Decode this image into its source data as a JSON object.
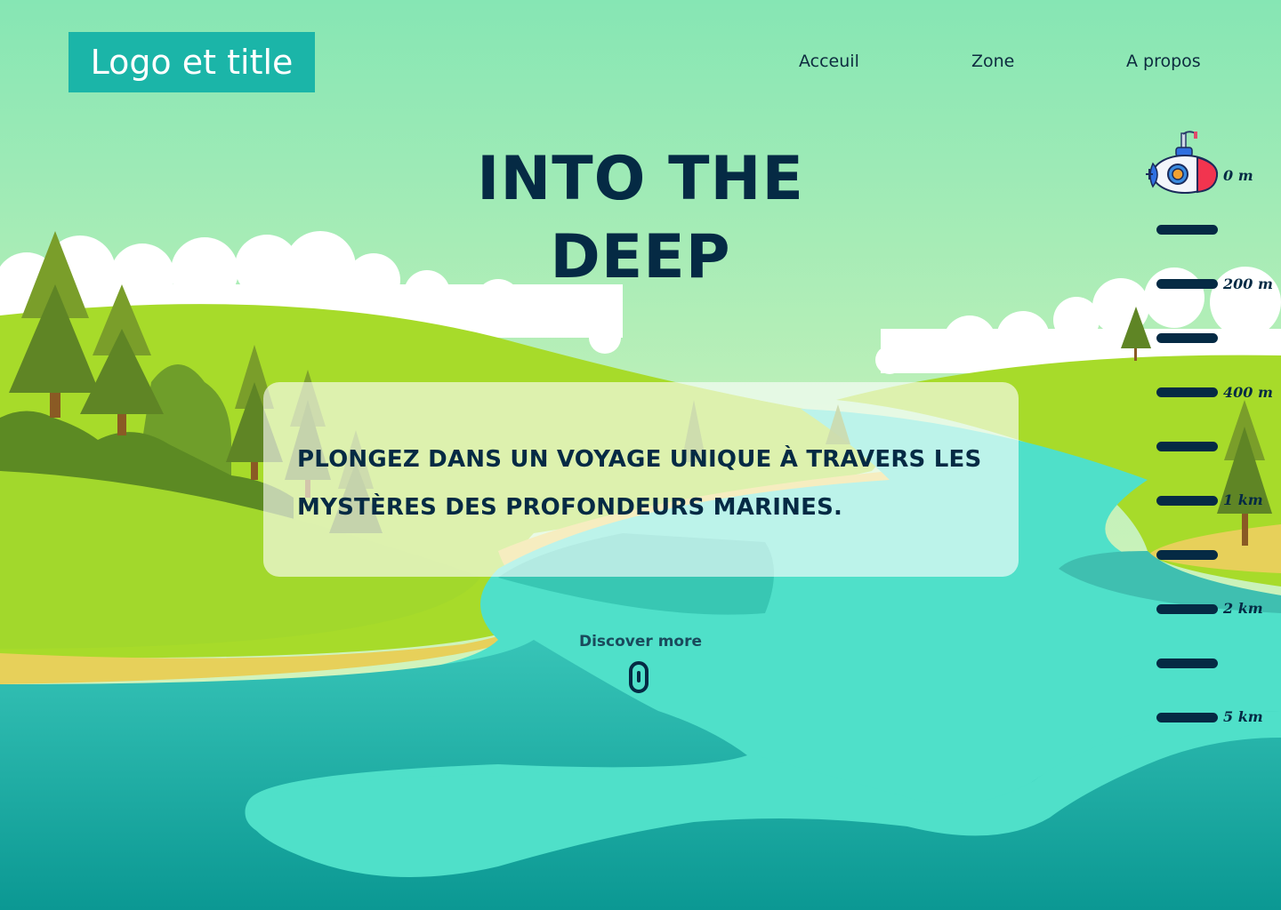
{
  "header": {
    "logo_text": "Logo et title",
    "nav": [
      "Acceuil",
      "Zone",
      "A propos"
    ]
  },
  "hero": {
    "title_line1": "INTO THE",
    "title_line2": "DEEP",
    "tagline": "PLONGEZ DANS UN VOYAGE UNIQUE À TRAVERS LES MYSTÈRES DES PROFONDEURS MARINES.",
    "discover_label": "Discover more"
  },
  "depth_gauge": {
    "labels": [
      "0 m",
      "200 m",
      "400 m",
      "1 km",
      "2 km",
      "5 km"
    ]
  },
  "icons": {
    "submarine": "submarine-icon",
    "scroll": "mouse-scroll-icon"
  },
  "colors": {
    "sky_top": "#86e6b4",
    "sky_bottom": "#d8f4bb",
    "hill": "#a7db2a",
    "water": "#4fe0c9",
    "water_deep": "#0d9c95",
    "logo_bg": "#1bb5a8",
    "ink": "#052a44"
  }
}
